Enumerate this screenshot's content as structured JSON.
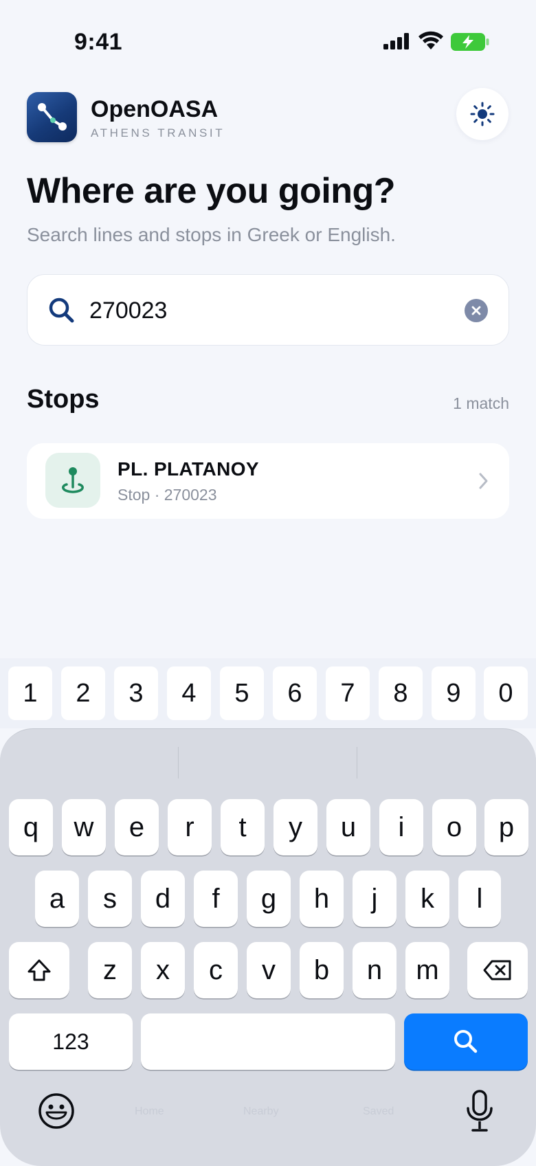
{
  "status_bar": {
    "time": "9:41",
    "battery_color": "#3ec93a"
  },
  "header": {
    "app_name": "OpenOASA",
    "app_subtitle": "ATHENS TRANSIT",
    "theme_toggle_icon": "sun-icon"
  },
  "main": {
    "headline": "Where are you going?",
    "subheadline": "Search lines and stops in Greek or English."
  },
  "search": {
    "value": "270023",
    "clear_icon": "clear-icon"
  },
  "results": {
    "section_title": "Stops",
    "count": "1 match",
    "items": [
      {
        "title": "PL. PLATANOY",
        "subtitle": "Stop · 270023",
        "icon": "stop-pin-icon"
      }
    ]
  },
  "keyboard": {
    "number_row": [
      "1",
      "2",
      "3",
      "4",
      "5",
      "6",
      "7",
      "8",
      "9",
      "0"
    ],
    "row1": [
      "q",
      "w",
      "e",
      "r",
      "t",
      "y",
      "u",
      "i",
      "o",
      "p"
    ],
    "row2": [
      "a",
      "s",
      "d",
      "f",
      "g",
      "h",
      "j",
      "k",
      "l"
    ],
    "row3": [
      "z",
      "x",
      "c",
      "v",
      "b",
      "n",
      "m"
    ],
    "mode_key": "123",
    "search_key_icon": "search-icon",
    "accent": "#0a7cff"
  },
  "tab_bar": {
    "items": [
      {
        "label": "Home"
      },
      {
        "label": "Nearby"
      },
      {
        "label": "Saved"
      }
    ]
  }
}
